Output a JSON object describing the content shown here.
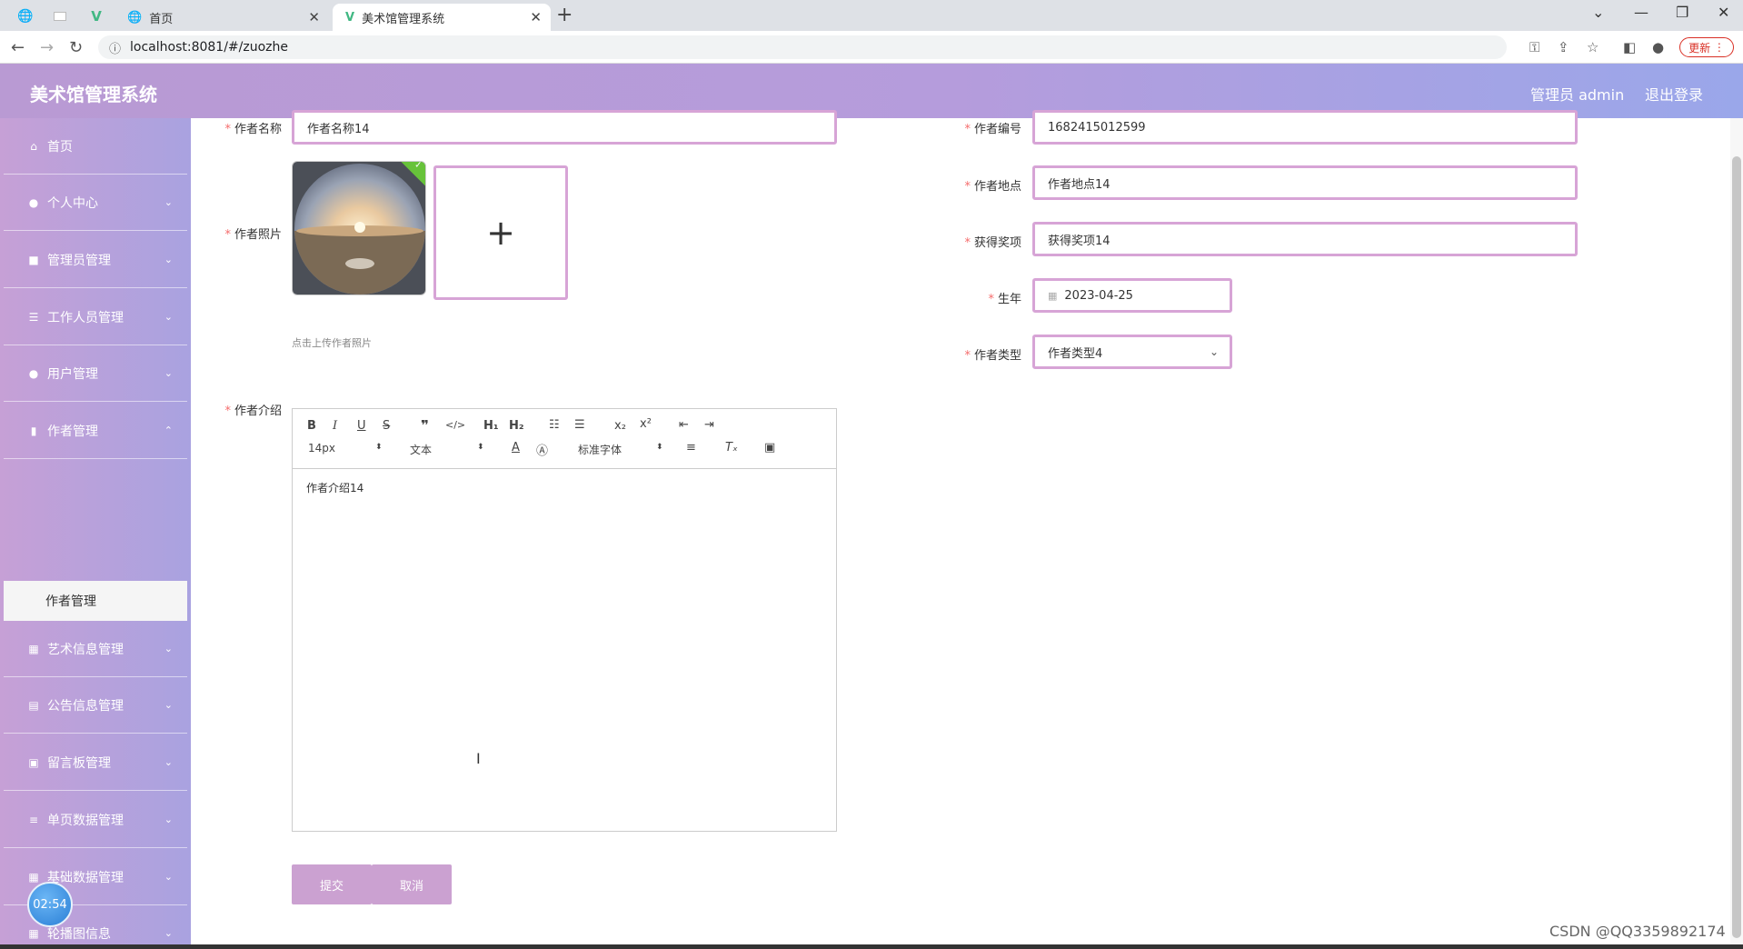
{
  "browser": {
    "tabs": [
      {
        "label": "首页",
        "active": false
      },
      {
        "label": "美术馆管理系统",
        "active": true
      }
    ],
    "new_tab": "+",
    "url": "localhost:8081/#/zuozhe",
    "update_label": "更新"
  },
  "header": {
    "title": "美术馆管理系统",
    "user": "管理员 admin",
    "logout": "退出登录"
  },
  "sidebar": {
    "items": [
      {
        "label": "首页",
        "icon": "home-icon",
        "glyph": "⌂"
      },
      {
        "label": "个人中心",
        "icon": "user-icon",
        "glyph": "●"
      },
      {
        "label": "管理员管理",
        "icon": "admin-icon",
        "glyph": "■"
      },
      {
        "label": "工作人员管理",
        "icon": "list-icon",
        "glyph": "☰"
      },
      {
        "label": "用户管理",
        "icon": "user-icon",
        "glyph": "●"
      },
      {
        "label": "作者管理",
        "icon": "chart-icon",
        "glyph": "▮"
      },
      {
        "label": "艺术信息管理",
        "icon": "grid-icon",
        "glyph": "▦"
      },
      {
        "label": "公告信息管理",
        "icon": "doc-icon",
        "glyph": "▤"
      },
      {
        "label": "留言板管理",
        "icon": "message-icon",
        "glyph": "▣"
      },
      {
        "label": "单页数据管理",
        "icon": "sliders-icon",
        "glyph": "≡"
      },
      {
        "label": "基础数据管理",
        "icon": "grid-icon",
        "glyph": "▦"
      },
      {
        "label": "轮播图信息",
        "icon": "grid-icon",
        "glyph": "▦"
      }
    ],
    "active_sub": "作者管理",
    "clock": "02:54"
  },
  "form": {
    "name_label": "作者名称",
    "name_value": "作者名称14",
    "code_label": "作者编号",
    "code_value": "1682415012599",
    "photo_label": "作者照片",
    "location_label": "作者地点",
    "location_value": "作者地点14",
    "award_label": "获得奖项",
    "award_value": "获得奖项14",
    "birth_label": "生年",
    "birth_value": "2023-04-25",
    "type_label": "作者类型",
    "type_value": "作者类型4",
    "upload_hint": "点击上传作者照片",
    "intro_label": "作者介绍",
    "intro_value": "作者介绍14",
    "toolbar": {
      "font_size": "14px",
      "heading": "文本",
      "font_family": "标准字体"
    },
    "submit": "提交",
    "cancel": "取消"
  },
  "watermark": "CSDN @QQ3359892174"
}
